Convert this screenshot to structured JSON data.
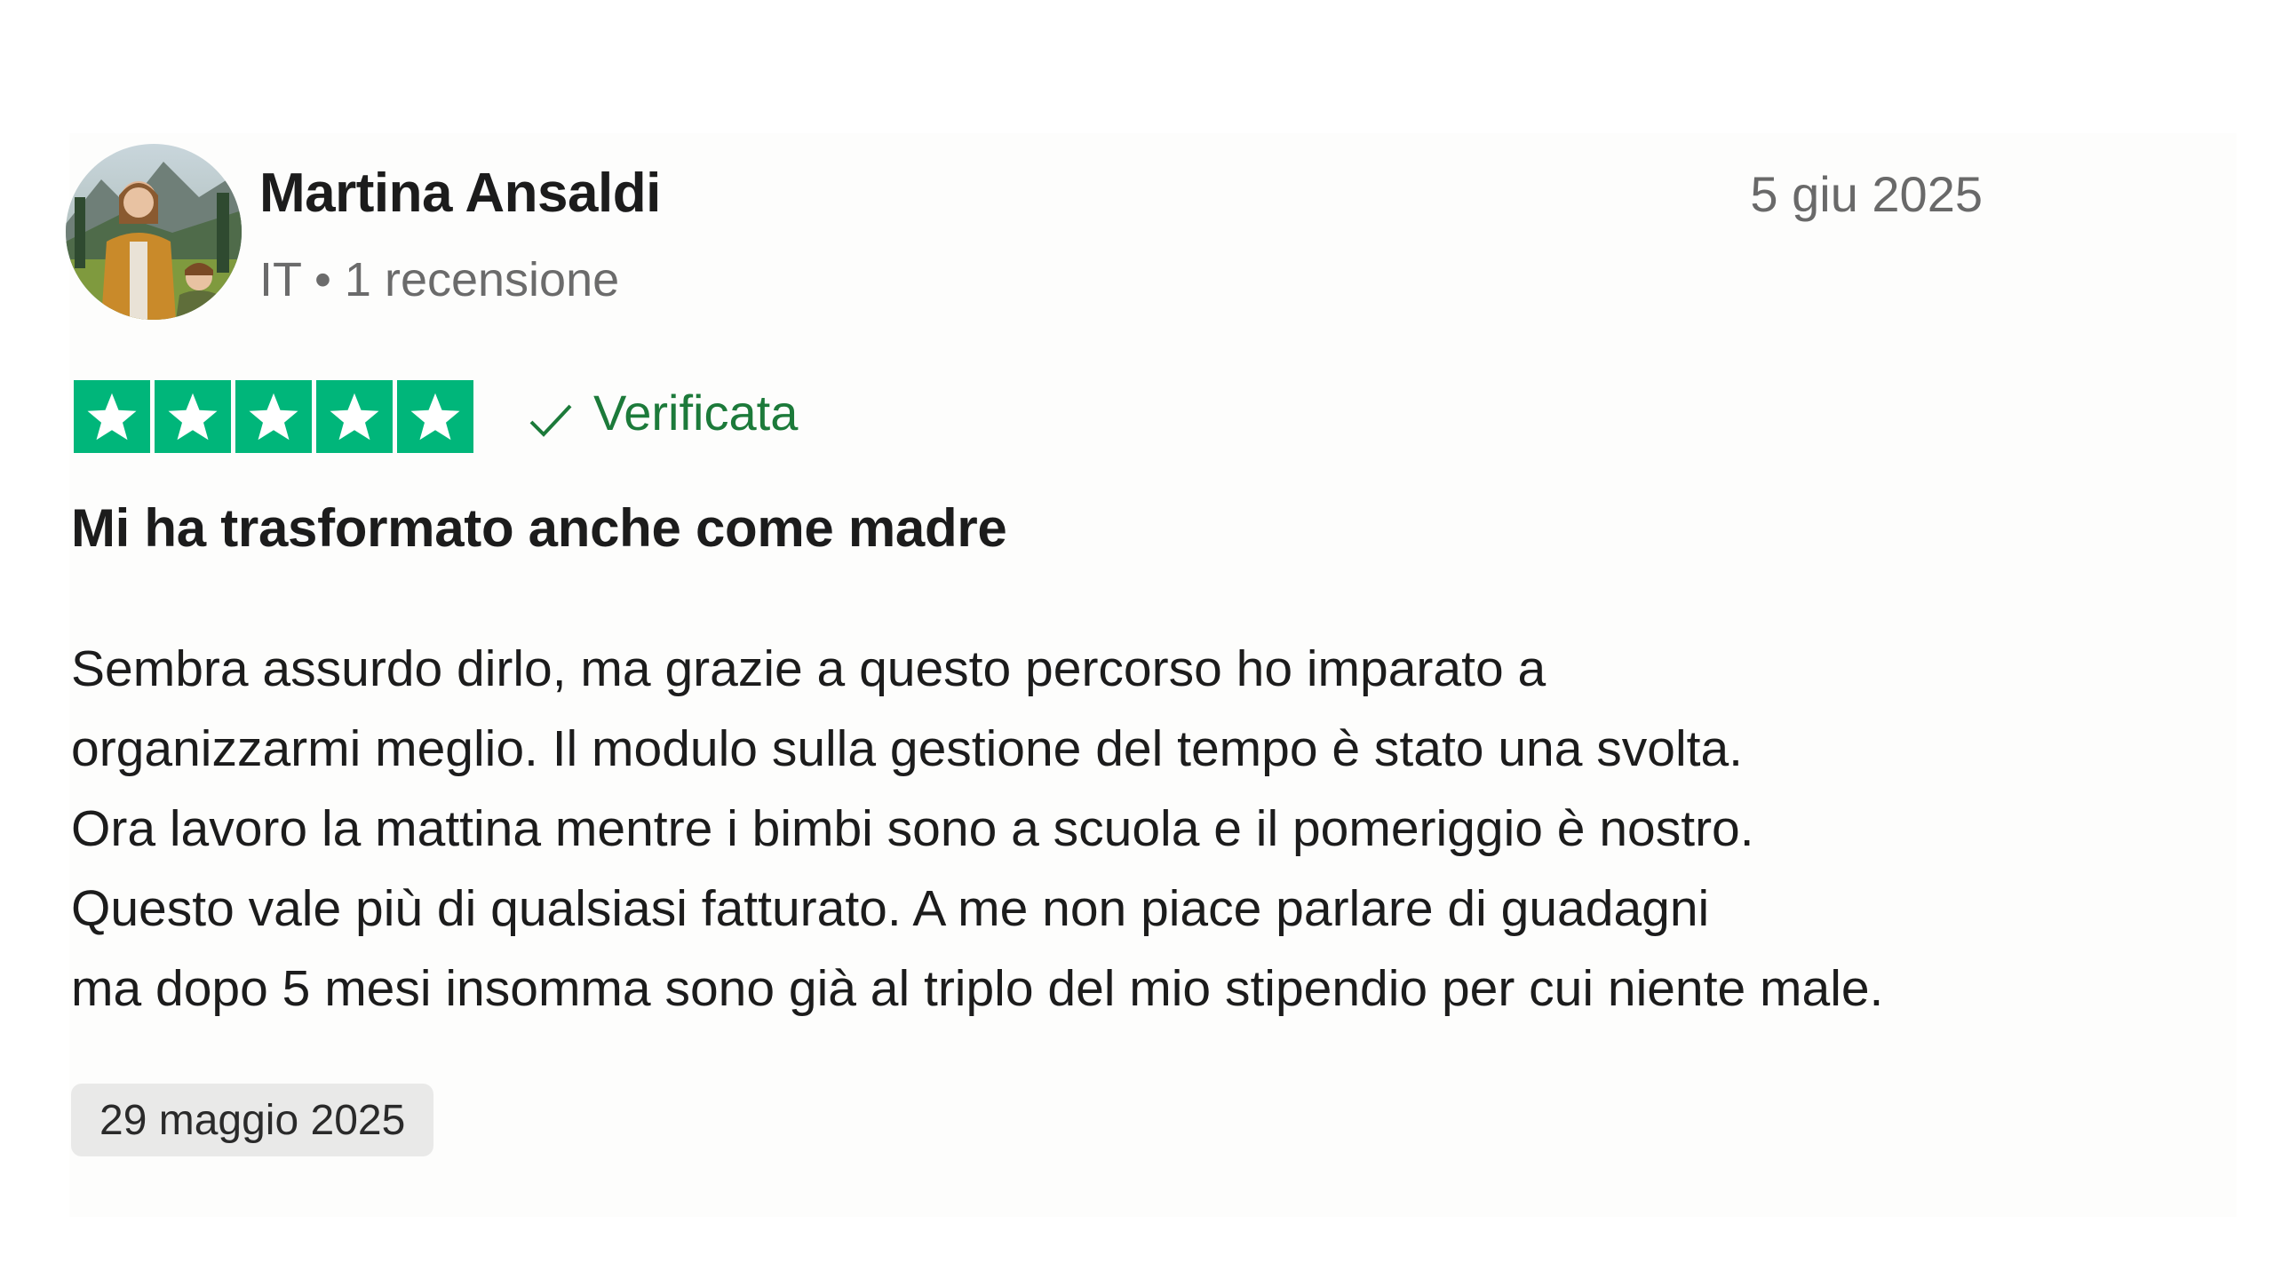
{
  "reviewer": {
    "name": "Martina Ansaldi",
    "meta": "IT • 1 recensione",
    "avatar_icon": "avatar-photo"
  },
  "review": {
    "date": "5 giu 2025",
    "rating": 5,
    "rating_max": 5,
    "star_color": "#00b67a",
    "verified_label": "Verificata",
    "verified_icon": "check-icon",
    "verified_color": "#1c7a3a",
    "title": "Mi ha trasformato anche come madre",
    "body_lines": [
      "Sembra assurdo dirlo, ma grazie a questo percorso ho imparato a",
      "organizzarmi meglio. Il modulo sulla gestione del tempo è stato una svolta.",
      "Ora lavoro la mattina mentre i bimbi sono a scuola e il pomeriggio è nostro.",
      "Questo vale più di qualsiasi fatturato.  A me non piace parlare di guadagni",
      "ma dopo 5 mesi insomma sono già al triplo del mio stipendio per cui niente male."
    ],
    "experience_date": "29 maggio 2025"
  }
}
